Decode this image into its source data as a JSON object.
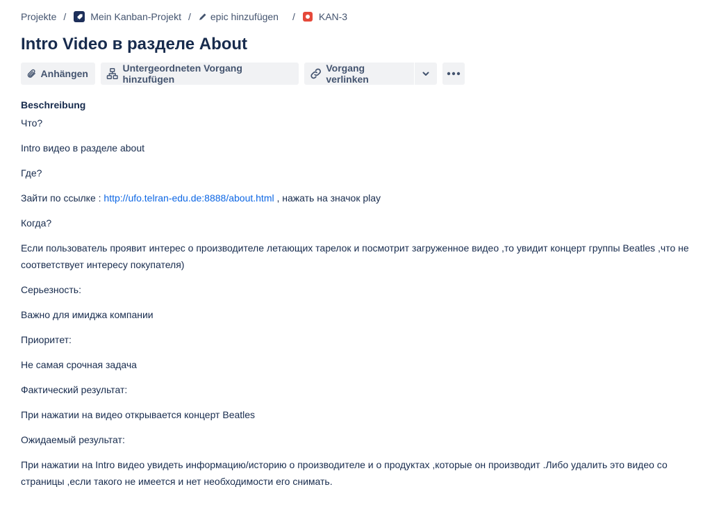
{
  "breadcrumb": {
    "projects": "Projekte",
    "project": "Mein Kanban-Projekt",
    "epic": "epic hinzufügen",
    "issue_key": "KAN-3",
    "separator": "/"
  },
  "issue": {
    "title": "Intro Video в разделе About"
  },
  "toolbar": {
    "attach_label": "Anhängen",
    "add_child_label": "Untergeordneten Vorgang hinzufügen",
    "link_issue_label": "Vorgang verlinken"
  },
  "description": {
    "heading": "Beschreibung",
    "what_label": "Что?",
    "what_value": "Intro видео в разделе about",
    "where_label": "Где?",
    "where_prefix": "Зайти по ссылке : ",
    "where_link": "http://ufo.telran-edu.de:8888/about.html",
    "where_suffix": " , нажать на значок play",
    "when_label": "Когда?",
    "when_line1": "Если пользователь проявит интерес о производителе летающих тарелок и посмотрит загруженное видео ,то увидит концерт группы Beatles ,что не",
    "when_line2": "соответствует интересу покупателя)",
    "severity_label": "Серьезность:",
    "severity_value": "Важно для имиджа компании",
    "priority_label": "Приоритет:",
    "priority_value": "Не самая срочная задача",
    "actual_label": "Фактический результат:",
    "actual_value": "При нажатии на видео открывается концерт Beatles",
    "expected_label": "Ожидаемый результат:",
    "expected_line1": "При нажатии на Intro видео увидеть информацию/историю о производителе и о продуктах ,которые он производит .Либо удалить это видео со",
    "expected_line2": "страницы ,если такого не имеется и нет необходимости его снимать."
  },
  "colors": {
    "text": "#172b4d",
    "subtle_text": "#44546f",
    "link": "#0c66e4",
    "button_bg": "#f1f2f4",
    "bug_icon": "#e5493a",
    "project_icon": "#1d2f5a"
  },
  "icons": [
    "rocket-icon",
    "pencil-icon",
    "bug-icon",
    "paperclip-icon",
    "hierarchy-icon",
    "link-icon",
    "chevron-down-icon",
    "more-icon"
  ]
}
